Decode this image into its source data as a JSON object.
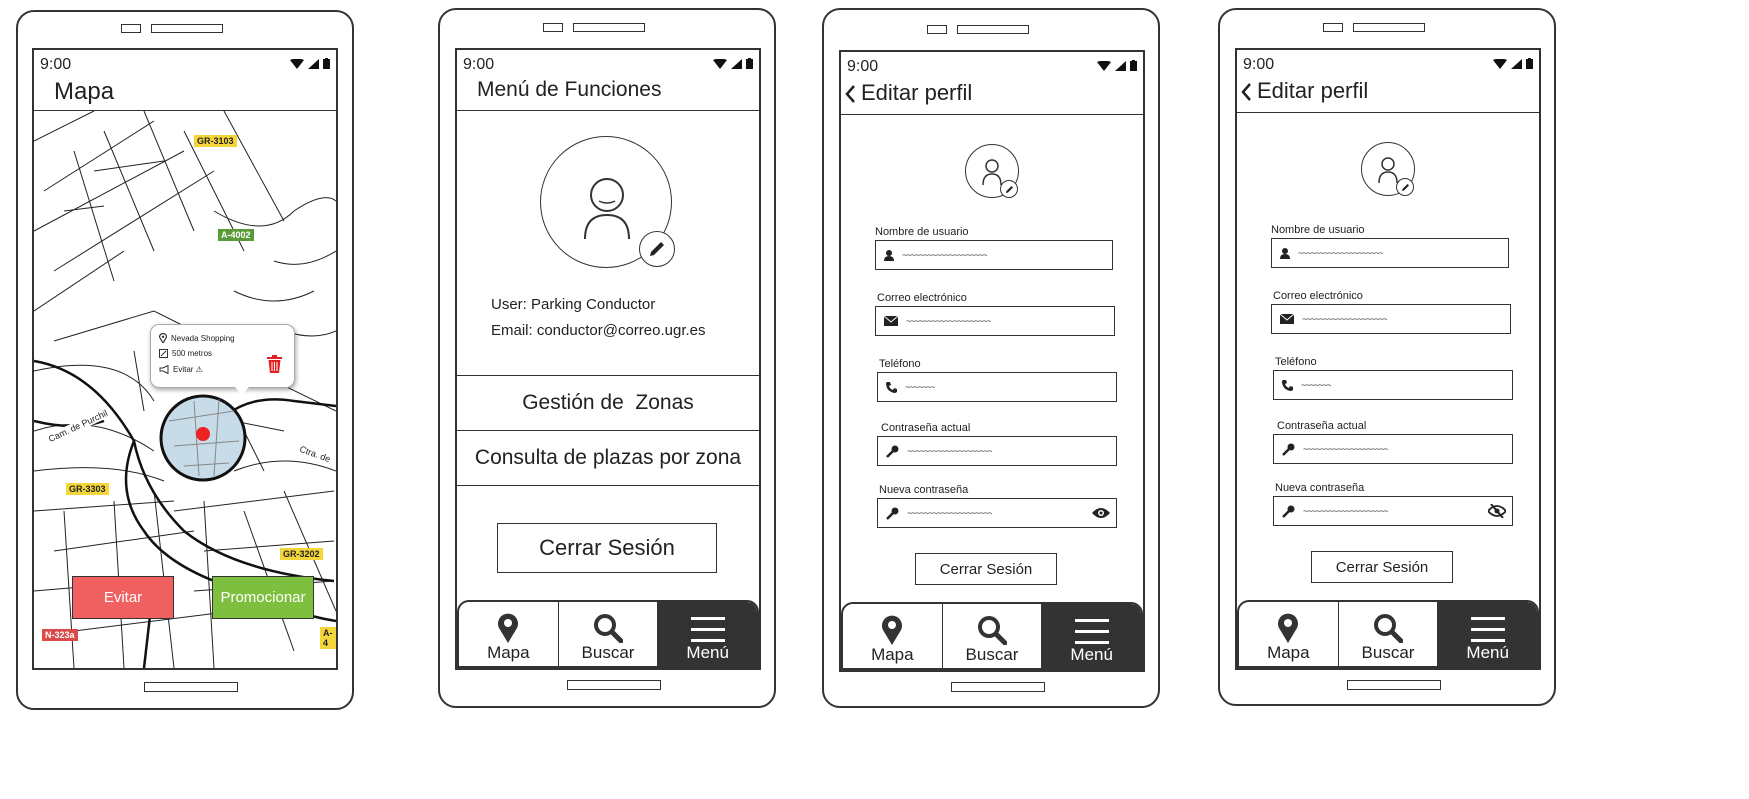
{
  "status": {
    "time": "9:00"
  },
  "nav": {
    "map": "Mapa",
    "search": "Buscar",
    "menu": "Menú"
  },
  "screen1": {
    "title": "Mapa",
    "roads": [
      "GR-3103",
      "A-4002",
      "GR-3303",
      "GR-3202",
      "N-323a",
      "A-4"
    ],
    "street_labels": [
      "Cam. de Purchil",
      "Ctra. de"
    ],
    "popup": {
      "place": "Nevada Shopping",
      "distance": "500 metros",
      "avoid": "Evitar ⚠"
    },
    "btn_avoid": "Evitar",
    "btn_promote": "Promocionar",
    "colors": {
      "avoid": "#f06060",
      "promote": "#7fbf3f"
    }
  },
  "screen2": {
    "title": "Menú de Funciones",
    "user_line": "User: Parking Conductor",
    "email_line": "Email: conductor@correo.ugr.es",
    "items": [
      "Gestión de  Zonas",
      "Consulta de plazas por zona"
    ],
    "logout": "Cerrar Sesión"
  },
  "screen3": {
    "title": "Editar perfil",
    "fields": [
      {
        "label": "Nombre de usuario",
        "value": "~~~~~~~~~~~~~~~~~~~~",
        "icon": "user-icon"
      },
      {
        "label": "Correo electrónico",
        "value": "~~~~~~~~~~~~~~~~~~~~",
        "icon": "envelope-icon"
      },
      {
        "label": "Teléfono",
        "value": "~~~~~~~",
        "icon": "phone-icon"
      },
      {
        "label": "Contraseña actual",
        "value": "~~~~~~~~~~~~~~~~~~~~",
        "icon": "key-icon"
      },
      {
        "label": "Nueva contraseña",
        "value": "~~~~~~~~~~~~~~~~~~~~",
        "icon": "key-icon"
      }
    ],
    "logout": "Cerrar Sesión"
  },
  "screen4": {
    "title": "Editar perfil",
    "fields": [
      {
        "label": "Nombre de usuario",
        "value": "~~~~~~~~~~~~~~~~~~~~",
        "icon": "user-icon"
      },
      {
        "label": "Correo electrónico",
        "value": "~~~~~~~~~~~~~~~~~~~~",
        "icon": "envelope-icon"
      },
      {
        "label": "Teléfono",
        "value": "~~~~~~~",
        "icon": "phone-icon"
      },
      {
        "label": "Contraseña actual",
        "value": "~~~~~~~~~~~~~~~~~~~~",
        "icon": "key-icon"
      },
      {
        "label": "Nueva contraseña",
        "value": "~~~~~~~~~~~~~~~~~~~~",
        "icon": "key-icon"
      }
    ],
    "logout": "Cerrar Sesión"
  }
}
